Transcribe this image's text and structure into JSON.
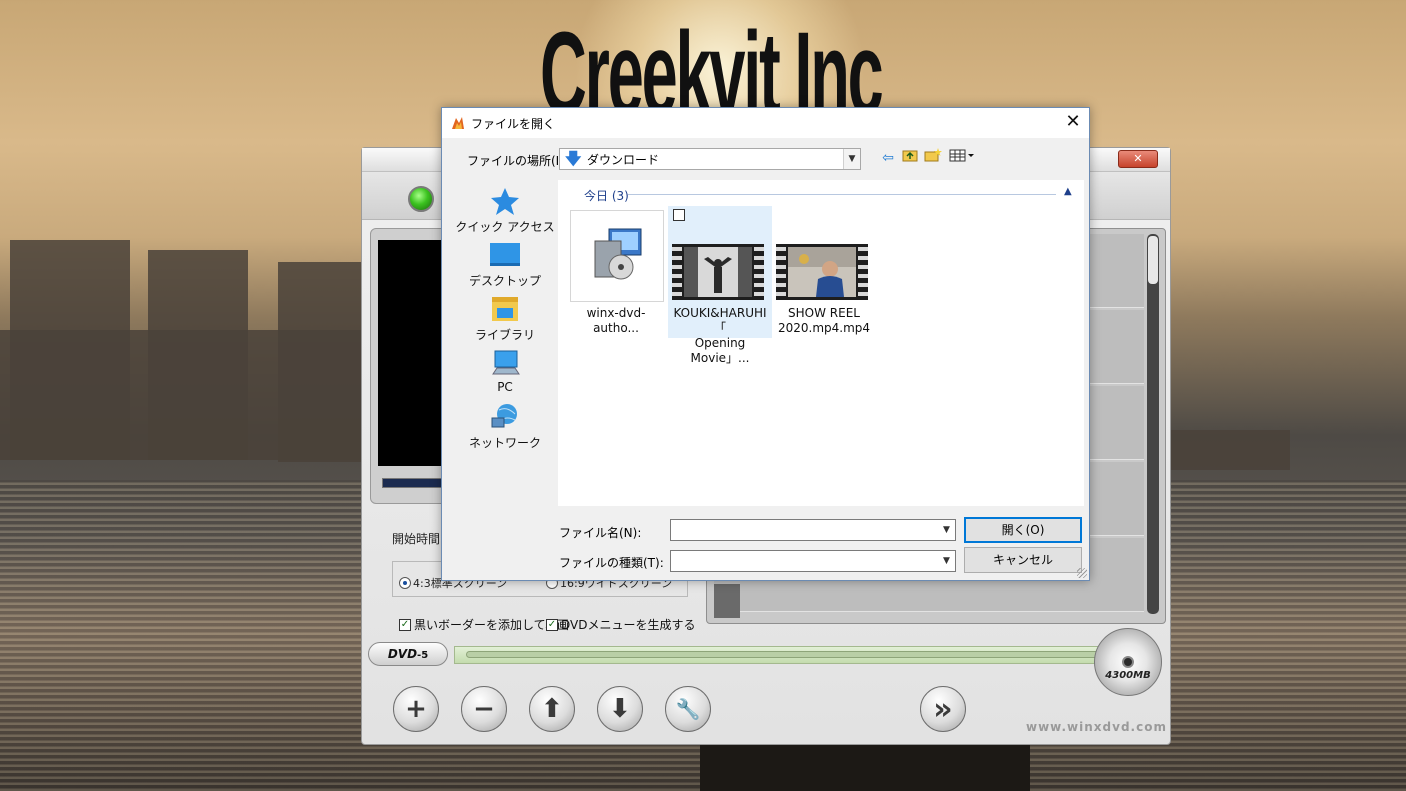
{
  "background": {
    "title": "Creekvit Inc"
  },
  "app": {
    "close_label": "✕",
    "start_time_label": "開始時間",
    "aspect_43_label": "4:3標準スクリーン",
    "aspect_169_label": "16:9ワイドスクリーン",
    "black_border_label": "黒いボーダーを添加して、画",
    "dvd_menu_label": "DVDメニューを生成する",
    "dvd_type": "DVD",
    "dvd_suffix": "-5",
    "disc_capacity": "4300MB",
    "footer_url": "www.winxdvd.com",
    "toolbar": {
      "add": "+",
      "remove": "−",
      "up": "⬆",
      "down": "⬇",
      "settings": "🔧",
      "next": "»"
    }
  },
  "dialog": {
    "title": "ファイルを開く",
    "close": "✕",
    "look_in_label": "ファイルの場所(I):",
    "look_in_value": "ダウンロード",
    "places": [
      {
        "label": "クイック アクセス",
        "icon": "star-icon"
      },
      {
        "label": "デスクトップ",
        "icon": "desktop-icon"
      },
      {
        "label": "ライブラリ",
        "icon": "library-icon"
      },
      {
        "label": "PC",
        "icon": "pc-icon"
      },
      {
        "label": "ネットワーク",
        "icon": "network-icon"
      }
    ],
    "group_header": "今日 (3)",
    "files": [
      {
        "name_line1": "winx-dvd-autho...",
        "name_line2": "",
        "selected": false
      },
      {
        "name_line1": "KOUKI&HARUHI「",
        "name_line2": "Opening Movie」...",
        "selected": true
      },
      {
        "name_line1": "SHOW REEL",
        "name_line2": "2020.mp4.mp4",
        "selected": false
      }
    ],
    "file_name_label": "ファイル名(N):",
    "file_name_value": "",
    "file_type_label": "ファイルの種類(T):",
    "file_type_value": "",
    "open_button": "開く(O)",
    "cancel_button": "キャンセル"
  }
}
